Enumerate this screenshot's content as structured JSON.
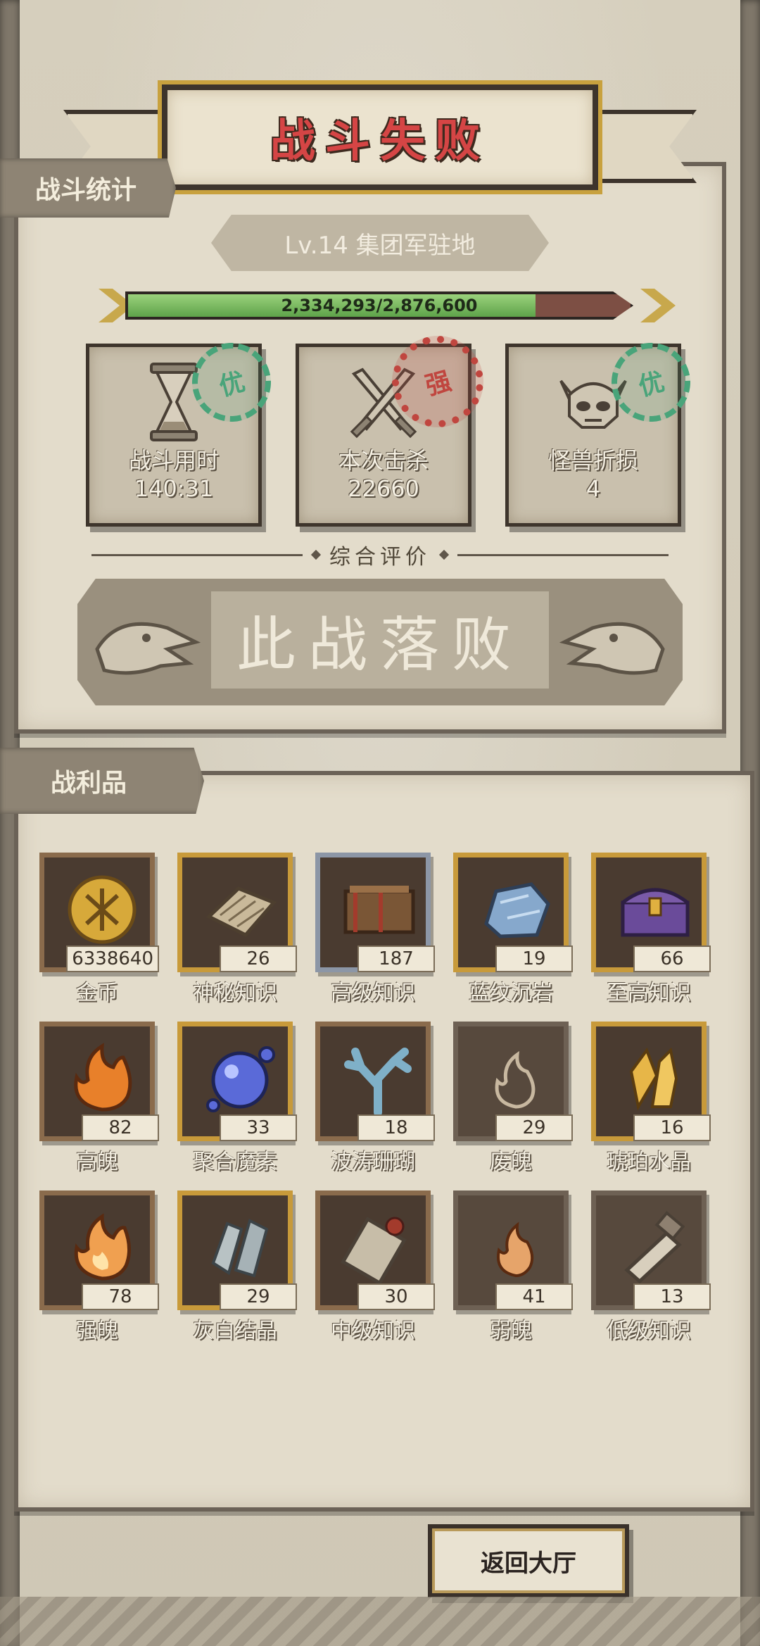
{
  "header": {
    "title": "战斗失败"
  },
  "stats_section": {
    "tag": "战斗统计",
    "level_label": "Lv.14 集团军驻地",
    "hp": {
      "text": "2,334,293/2,876,600",
      "current": 2334293,
      "max": 2876600
    },
    "cards": [
      {
        "label": "战斗用时",
        "value": "140:31",
        "icon": "hourglass-icon",
        "stamp": "优",
        "stamp_color": "#49a47a"
      },
      {
        "label": "本次击杀",
        "value": "22660",
        "icon": "crossed-swords-icon",
        "stamp": "强",
        "stamp_color": "#c0463f"
      },
      {
        "label": "怪兽折损",
        "value": "4",
        "icon": "monster-skull-icon",
        "stamp": "优",
        "stamp_color": "#49a47a"
      }
    ],
    "evaluation_label": "综合评价",
    "evaluation_result": "此战落败"
  },
  "loot_section": {
    "tag": "战利品",
    "items": [
      {
        "name": "金币",
        "count": "6338640",
        "icon": "gold-coin-icon",
        "frame": "brown"
      },
      {
        "name": "神秘知识",
        "count": "26",
        "icon": "stone-tablet-icon",
        "frame": "gold"
      },
      {
        "name": "高级知识",
        "count": "187",
        "icon": "bound-book-icon",
        "frame": "silver"
      },
      {
        "name": "蓝纹沉岩",
        "count": "19",
        "icon": "blue-ore-icon",
        "frame": "gold"
      },
      {
        "name": "至高知识",
        "count": "66",
        "icon": "treasure-chest-icon",
        "frame": "gold"
      },
      {
        "name": "高魄",
        "count": "82",
        "icon": "orange-flame-icon",
        "frame": "brown"
      },
      {
        "name": "聚合魔素",
        "count": "33",
        "icon": "magic-orb-icon",
        "frame": "gold"
      },
      {
        "name": "波涛珊瑚",
        "count": "18",
        "icon": "coral-icon",
        "frame": "brown"
      },
      {
        "name": "废魄",
        "count": "29",
        "icon": "faint-flame-icon",
        "frame": "plain"
      },
      {
        "name": "琥珀水晶",
        "count": "16",
        "icon": "amber-crystal-icon",
        "frame": "gold"
      },
      {
        "name": "强魄",
        "count": "78",
        "icon": "strong-flame-icon",
        "frame": "brown"
      },
      {
        "name": "灰白结晶",
        "count": "29",
        "icon": "grey-crystal-icon",
        "frame": "gold"
      },
      {
        "name": "中级知识",
        "count": "30",
        "icon": "scroll-icon",
        "frame": "brown"
      },
      {
        "name": "弱魄",
        "count": "41",
        "icon": "weak-flame-icon",
        "frame": "plain"
      },
      {
        "name": "低级知识",
        "count": "13",
        "icon": "rolled-paper-icon",
        "frame": "plain"
      }
    ]
  },
  "footer": {
    "return_button": "返回大厅"
  }
}
